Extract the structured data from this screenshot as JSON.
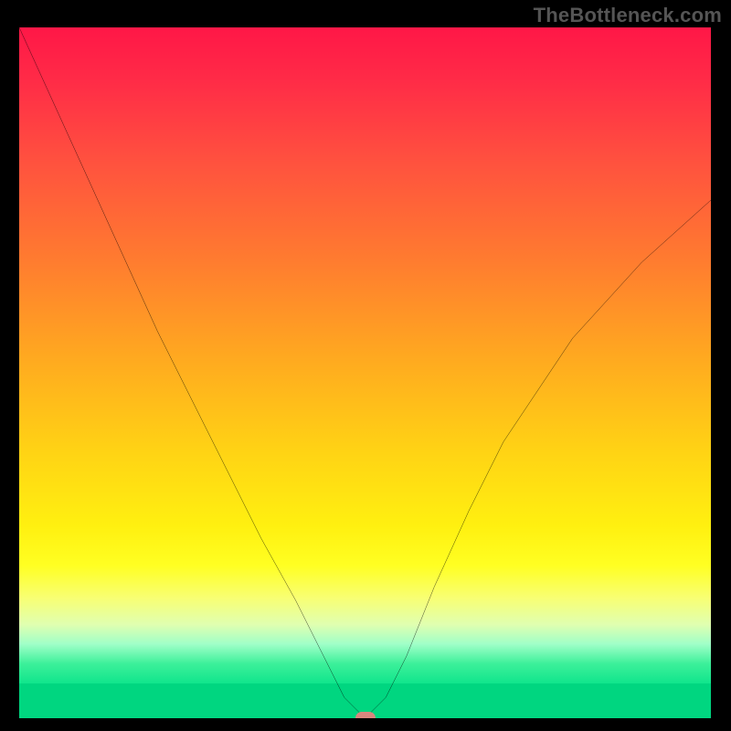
{
  "watermark": "TheBottleneck.com",
  "chart_data": {
    "type": "line",
    "title": "",
    "xlabel": "",
    "ylabel": "",
    "xlim": [
      0,
      100
    ],
    "ylim": [
      0,
      100
    ],
    "grid": false,
    "series": [
      {
        "name": "bottleneck-curve",
        "x": [
          0,
          10,
          20,
          30,
          35,
          40,
          44,
          47,
          50,
          53,
          56,
          60,
          65,
          70,
          80,
          90,
          100
        ],
        "values": [
          100,
          78,
          56,
          36,
          26,
          17,
          9,
          3,
          0,
          3,
          9,
          19,
          30,
          40,
          55,
          66,
          75
        ]
      }
    ],
    "marker": {
      "x": 50,
      "y": 0,
      "color": "#d9877f"
    },
    "background_gradient": {
      "top": "#ff1747",
      "middle": "#ffd414",
      "bottom": "#10e58c"
    }
  }
}
